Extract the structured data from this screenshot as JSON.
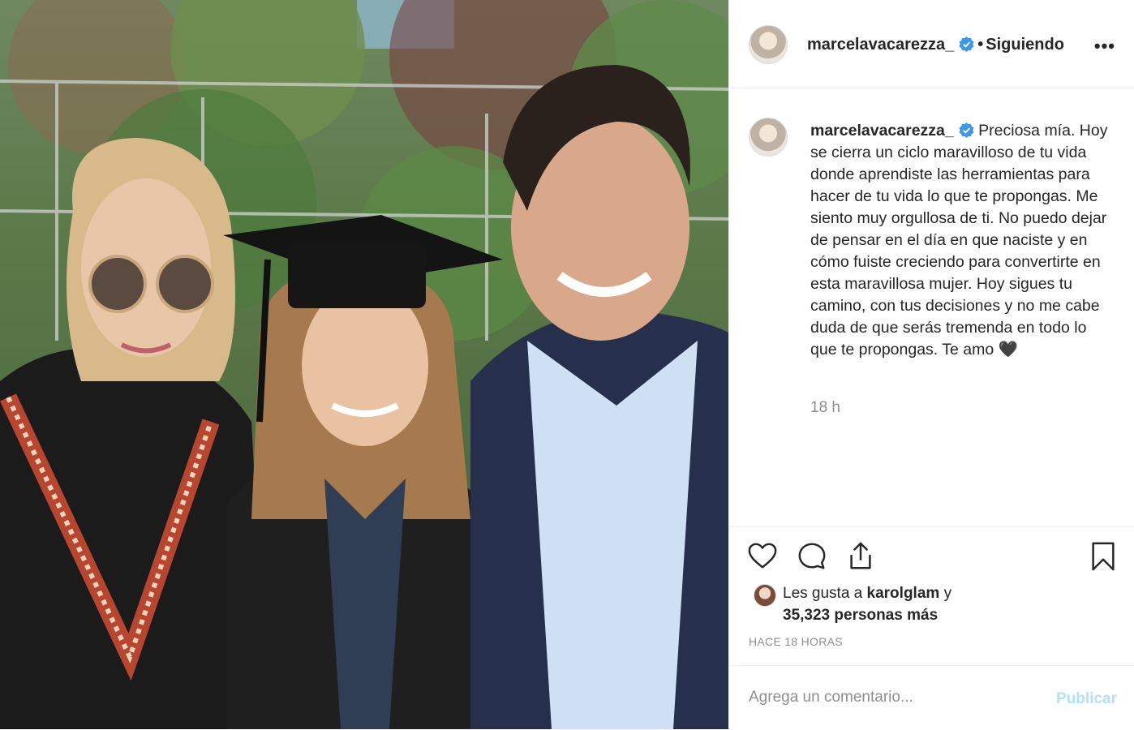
{
  "post": {
    "photo_alt": "",
    "author": {
      "username": "marcelavacarezza_",
      "separator": "•",
      "follow_status": "Siguiendo",
      "more_label": "•••"
    },
    "caption": {
      "username": "marcelavacarezza_",
      "text": "Preciosa mía. Hoy se cierra un ciclo maravilloso de tu vida donde aprendiste las herramientas para hacer de tu vida lo que te propongas. Me siento muy orgullosa de ti. No puedo dejar de pensar en el día en que naciste y en cómo fuiste creciendo para convertirte en esta maravillosa mujer. Hoy sigues tu camino, con tus decisiones y no me cabe duda de que serás tremenda en todo lo que te propongas. Te amo 🖤",
      "time": "18 h"
    },
    "likes": {
      "prefix": "Les gusta a",
      "liker": "karolglam",
      "joiner": "y",
      "count_text": "35,323 personas más"
    },
    "posted_ago": "Hace 18 horas",
    "comment": {
      "placeholder": "Agrega un comentario...",
      "publish_label": "Publicar"
    }
  },
  "colors": {
    "verified_blue": "#3897f0",
    "muted_text": "#8e8e8e",
    "publish_disabled": "#b2dffc",
    "border": "#efefef"
  },
  "icons": [
    "verified-badge-icon",
    "more-options-icon",
    "heart-icon",
    "comment-icon",
    "share-icon",
    "bookmark-icon"
  ]
}
